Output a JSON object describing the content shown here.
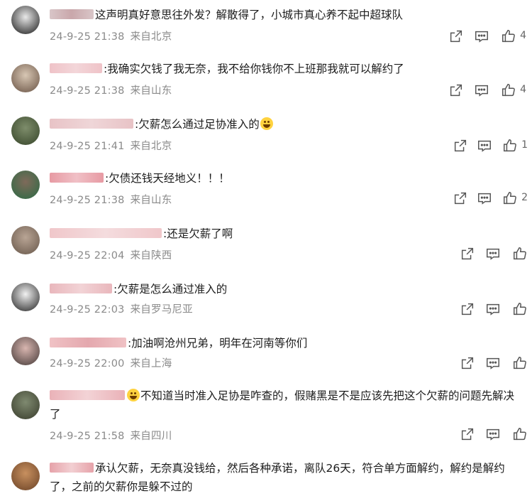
{
  "comments": [
    {
      "text": "这声明真好意思往外发？解散得了，小城市真心养不起中超球队",
      "date": "24-9-25 21:38",
      "location": "来自北京",
      "likes": "4",
      "avatar_colors": [
        "#e9e9e9",
        "#222222"
      ],
      "name_colors": [
        "#d9c6c8",
        "#c9a7ab"
      ]
    },
    {
      "text": ":我确实欠钱了我无奈，我不给你钱你不上班那我就可以解约了",
      "date": "24-9-25 21:38",
      "location": "来自山东",
      "likes": "4",
      "avatar_colors": [
        "#d8c7b4",
        "#6d5748"
      ],
      "name_colors": [
        "#efc3c8",
        "#f3d6d9"
      ]
    },
    {
      "text": ":欠薪怎么通过足协准入的",
      "emoji": "grinning-sweat-emoji",
      "date": "24-9-25 21:41",
      "location": "来自北京",
      "likes": "1",
      "avatar_colors": [
        "#7e8d6b",
        "#39482c"
      ],
      "name_colors": [
        "#e8c3c6",
        "#efd6d8"
      ]
    },
    {
      "text": ":欠债还钱天经地义！！！",
      "date": "24-9-25 21:38",
      "location": "来自山东",
      "likes": "2",
      "avatar_colors": [
        "#7f6a5a",
        "#2e6a45"
      ],
      "name_colors": [
        "#e79aa3",
        "#f0c0c6"
      ]
    },
    {
      "text": ":还是欠薪了啊",
      "date": "24-9-25 22:04",
      "location": "来自陕西",
      "likes": "",
      "avatar_colors": [
        "#b9a595",
        "#6b5a4d"
      ],
      "name_colors": [
        "#f0c7ca",
        "#f4dcde"
      ]
    },
    {
      "text": ":欠薪是怎么通过准入的",
      "date": "24-9-25 22:03",
      "location": "来自罗马尼亚",
      "likes": "",
      "avatar_colors": [
        "#f2f2f2",
        "#2a2a2a"
      ],
      "name_colors": [
        "#e9b7bc",
        "#f2d3d6"
      ]
    },
    {
      "text": ":加油啊沧州兄弟，明年在河南等你们",
      "date": "24-9-25 22:00",
      "location": "来自上海",
      "likes": "",
      "avatar_colors": [
        "#d9b6b0",
        "#4a3e3c"
      ],
      "name_colors": [
        "#f0c2c5",
        "#e4a8ae"
      ]
    },
    {
      "text": "不知道当时准入足协是咋查的，假赌黑是不是应该先把这个欠薪的问题先解决了",
      "emoji_before": "grinning-sweat-emoji",
      "date": "24-9-25 21:58",
      "location": "来自四川",
      "likes": "",
      "avatar_colors": [
        "#7f8a70",
        "#3b3f2e"
      ],
      "name_colors": [
        "#eab2b8",
        "#f3d3d6"
      ]
    },
    {
      "text": "承认欠薪，无奈真没钱给，然后各种承诺，离队26天，符合单方面解约，解约是解约了，之前的欠薪你是躲不过的",
      "date": "",
      "location": "",
      "likes": "",
      "avatar_colors": [
        "#c8905f",
        "#6e4528"
      ],
      "name_colors": [
        "#e6a2a9",
        "#f2cfd2"
      ]
    }
  ],
  "icons": [
    "share-icon",
    "comment-icon",
    "like-icon"
  ]
}
